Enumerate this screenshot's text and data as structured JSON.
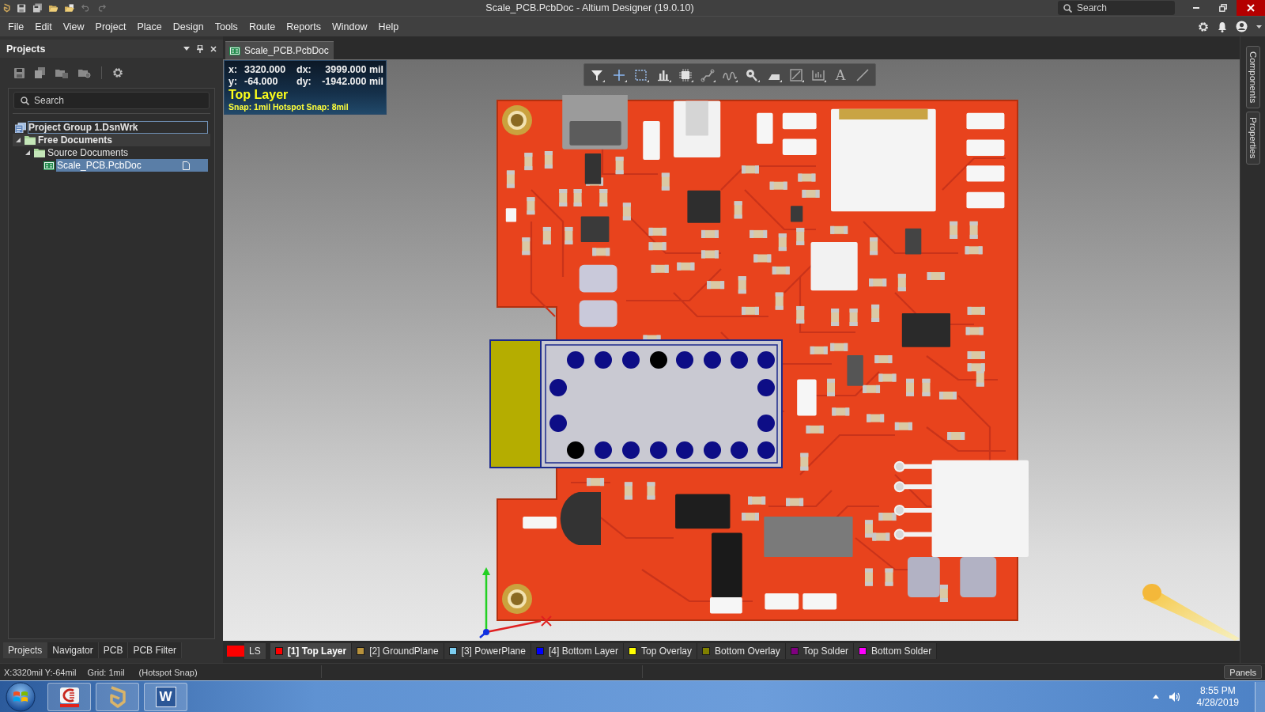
{
  "window": {
    "title": "Scale_PCB.PcbDoc - Altium Designer (19.0.10)",
    "search": {
      "placeholder": "Search"
    }
  },
  "menu": [
    "File",
    "Edit",
    "View",
    "Project",
    "Place",
    "Design",
    "Tools",
    "Route",
    "Reports",
    "Window",
    "Help"
  ],
  "projects_panel": {
    "title": "Projects",
    "search": {
      "placeholder": "Search"
    },
    "tree": [
      {
        "label": "Project Group 1.DsnWrk",
        "kind": "workspace",
        "selected": false,
        "focused": true
      },
      {
        "label": "Free Documents",
        "kind": "group",
        "selected": false,
        "focused": false,
        "expanded": true,
        "children": [
          {
            "label": "Source Documents",
            "kind": "folder",
            "selected": false,
            "focused": false,
            "expanded": true,
            "children": [
              {
                "label": "Scale_PCB.PcbDoc",
                "kind": "document",
                "selected": true,
                "focused": false
              }
            ]
          }
        ]
      }
    ],
    "tabs": [
      {
        "label": "Projects",
        "selected": true
      },
      {
        "label": "Navigator",
        "selected": false
      },
      {
        "label": "PCB",
        "selected": false
      },
      {
        "label": "PCB Filter",
        "selected": false
      }
    ]
  },
  "document_tabs": [
    {
      "label": "Scale_PCB.PcbDoc",
      "selected": true
    }
  ],
  "viewport": {
    "readout": {
      "rows": [
        {
          "axis": "x:",
          "value": "3320.000",
          "delta_axis": "dx:",
          "delta": "3999.000 mil"
        },
        {
          "axis": "y:",
          "value": "-64.000",
          "delta_axis": "dy:",
          "delta": "-1942.000 mil"
        }
      ],
      "layer": "Top Layer",
      "snap": "Snap: 1mil Hotspot Snap: 8mil"
    },
    "toolbar": {
      "text_tool": "A"
    }
  },
  "layer_tabs": {
    "current": {
      "label": "LS",
      "color": "#ff0000"
    },
    "layers": [
      {
        "label": "[1] Top Layer",
        "color": "#ff0000",
        "selected": true
      },
      {
        "label": "[2] GroundPlane",
        "color": "#b8923c",
        "selected": false
      },
      {
        "label": "[3] PowerPlane",
        "color": "#7ccdf0",
        "selected": false
      },
      {
        "label": "[4] Bottom Layer",
        "color": "#0000ff",
        "selected": false
      },
      {
        "label": "Top Overlay",
        "color": "#ffff00",
        "selected": false
      },
      {
        "label": "Bottom Overlay",
        "color": "#808000",
        "selected": false
      },
      {
        "label": "Top Solder",
        "color": "#800080",
        "selected": false
      },
      {
        "label": "Bottom Solder",
        "color": "#ff00ff",
        "selected": false
      }
    ]
  },
  "side_tabs": [
    "Components",
    "Properties"
  ],
  "status_bar": {
    "items": [
      "X:3320mil Y:-64mil",
      "Grid: 1mil",
      "(Hotspot Snap)"
    ],
    "panels_button": "Panels"
  },
  "taskbar": {
    "apps": [
      {
        "kind": "emblem"
      },
      {
        "kind": "logo"
      },
      {
        "kind": "letter",
        "glyph": "W"
      }
    ],
    "clock": {
      "time": "8:55 PM",
      "date": "4/28/2019"
    }
  }
}
